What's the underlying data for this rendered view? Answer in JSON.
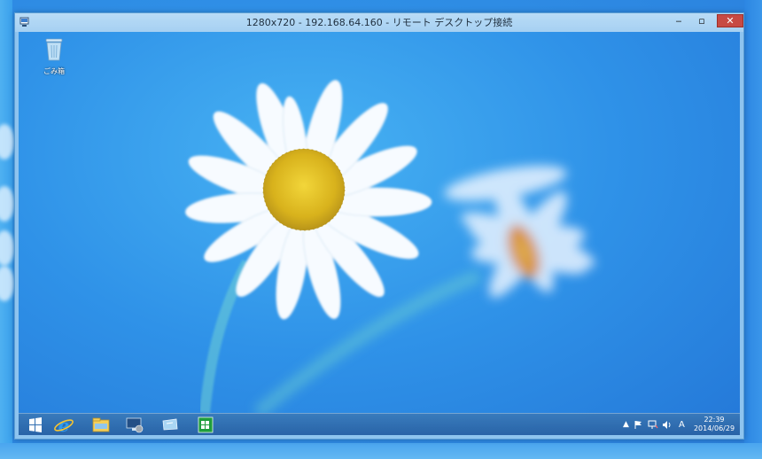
{
  "window": {
    "title": "1280x720 - 192.168.64.160 - リモート デスクトップ接続",
    "minimize_glyph": "‒",
    "maximize_glyph": "▫",
    "close_glyph": "✕"
  },
  "desktop": {
    "icons": [
      {
        "label": "ごみ箱",
        "icon": "recycle-bin-icon"
      }
    ]
  },
  "taskbar": {
    "apps": [
      {
        "name": "start",
        "icon": "windows-start-icon"
      },
      {
        "name": "ie",
        "icon": "internet-explorer-icon"
      },
      {
        "name": "explorer",
        "icon": "file-explorer-icon"
      },
      {
        "name": "server-manager",
        "icon": "server-manager-icon"
      },
      {
        "name": "remote-desktop",
        "icon": "remote-desktop-icon"
      },
      {
        "name": "store",
        "icon": "windows-store-icon"
      }
    ],
    "tray": {
      "chevron": "▲",
      "ime": "A"
    },
    "clock": {
      "time": "22:39",
      "date": "2014/06/29"
    }
  }
}
